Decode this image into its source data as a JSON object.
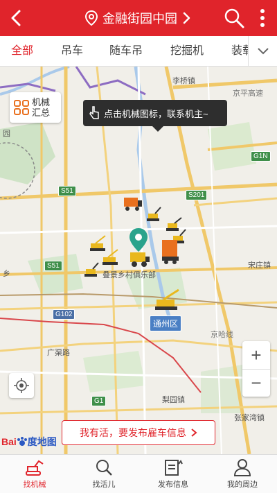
{
  "header": {
    "location": "金融街园中园",
    "back_icon": "back-arrow-icon",
    "search_icon": "search-icon",
    "more_icon": "more-vertical-icon",
    "bg_color": "#e0242b"
  },
  "tabs": {
    "items": [
      {
        "label": "全部",
        "active": true
      },
      {
        "label": "吊车",
        "active": false
      },
      {
        "label": "随车吊",
        "active": false
      },
      {
        "label": "挖掘机",
        "active": false
      },
      {
        "label": "装载",
        "active": false
      }
    ],
    "more_icon": "chevron-down-icon"
  },
  "map": {
    "summary_label": "机械汇总",
    "tooltip": "点击机械图标，联系机主~",
    "district": "通州区",
    "place_labels": {
      "litiao": "李桥镇",
      "jingping": "京平高速",
      "songzhuang": "宋庄镇",
      "diejing": "叠景乡村俱乐部",
      "guangqu": "广渠路",
      "liyuan": "梨园镇",
      "zhangjiawan": "张家湾镇",
      "yuan": "园",
      "xiang": "乡",
      "jingha": "京哈线"
    },
    "road_shields": [
      "S51",
      "S51",
      "G102",
      "G1",
      "G1N",
      "S201"
    ],
    "zoom_in": "+",
    "zoom_out": "−",
    "hire_banner": "我有活，要发布雇车信息",
    "logo_bai": "Bai",
    "logo_du": "度地图"
  },
  "bottom_nav": [
    {
      "label": "找机械",
      "icon": "excavator-icon",
      "active": true
    },
    {
      "label": "找活儿",
      "icon": "search-job-icon",
      "active": false
    },
    {
      "label": "发布信息",
      "icon": "publish-icon",
      "active": false
    },
    {
      "label": "我的周边",
      "icon": "person-icon",
      "active": false
    }
  ]
}
